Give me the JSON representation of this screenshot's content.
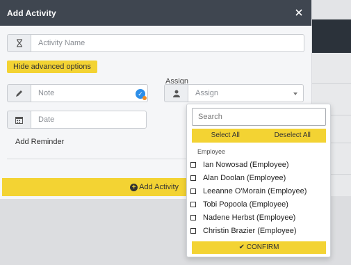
{
  "modal": {
    "title": "Add Activity",
    "activity_name_placeholder": "Activity Name",
    "advanced_toggle_label": "Hide advanced options",
    "note_placeholder": "Note",
    "assign_label": "Assign",
    "assign_placeholder": "Assign",
    "date_placeholder": "Date",
    "add_reminder_label": "Add Reminder",
    "submit_label": "Add Activity"
  },
  "assign_dropdown": {
    "search_placeholder": "Search",
    "select_all_label": "Select All",
    "deselect_all_label": "Deselect All",
    "group_label": "Employee",
    "options": [
      "Ian Nowosad (Employee)",
      "Alan Doolan (Employee)",
      "Leeanne O'Morain (Employee)",
      "Tobi Popoola (Employee)",
      "Nadene Herbst (Employee)",
      "Christin Brazier (Employee)"
    ],
    "confirm_label": "CONFIRM"
  },
  "icons": {
    "close": "close-icon",
    "activity_name": "hourglass-icon",
    "note": "pencil-icon",
    "assign": "user-icon",
    "date": "calendar-icon",
    "note_badge": "check-circle-icon",
    "submit": "plus-circle-icon",
    "confirm": "checkmark-icon"
  },
  "colors": {
    "header_bg": "#3f4650",
    "accent_yellow": "#f3d333",
    "badge_blue": "#2d8ee8"
  }
}
